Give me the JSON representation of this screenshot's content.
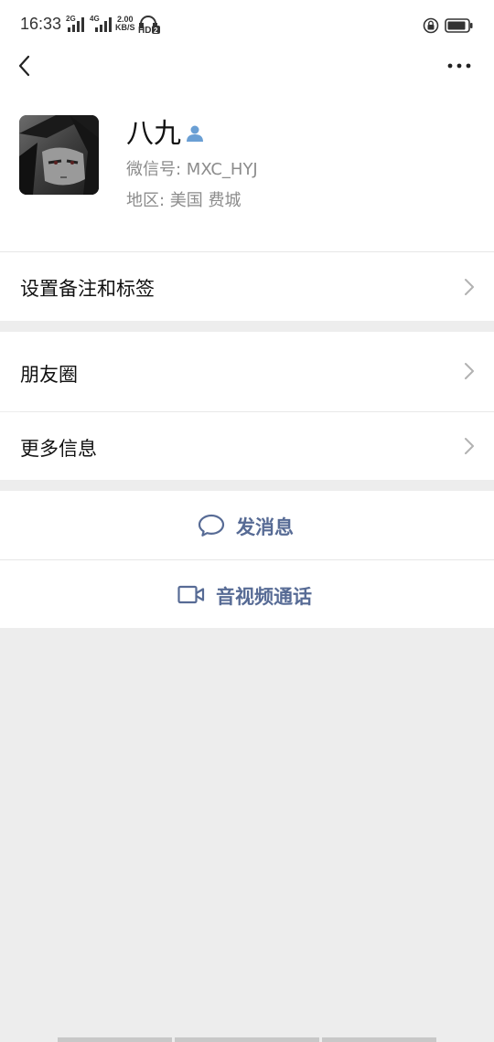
{
  "status_bar": {
    "time": "16:33",
    "signal1_label": "2G",
    "signal2_label": "4G",
    "net_speed_value": "2.00",
    "net_speed_unit": "KB/S",
    "hd_label": "HD",
    "hd_sub": "2"
  },
  "profile": {
    "name": "八九",
    "wechat_id": "微信号: MXC_HYJ",
    "region": "地区: 美国  费城"
  },
  "menu": {
    "set_remark": "设置备注和标签",
    "moments": "朋友圈",
    "more_info": "更多信息"
  },
  "actions": {
    "send_message": "发消息",
    "video_call": "音视频通话"
  },
  "colors": {
    "link_blue": "#576b95",
    "background_gray": "#ededed",
    "contact_icon_blue": "#6a9fd4"
  }
}
